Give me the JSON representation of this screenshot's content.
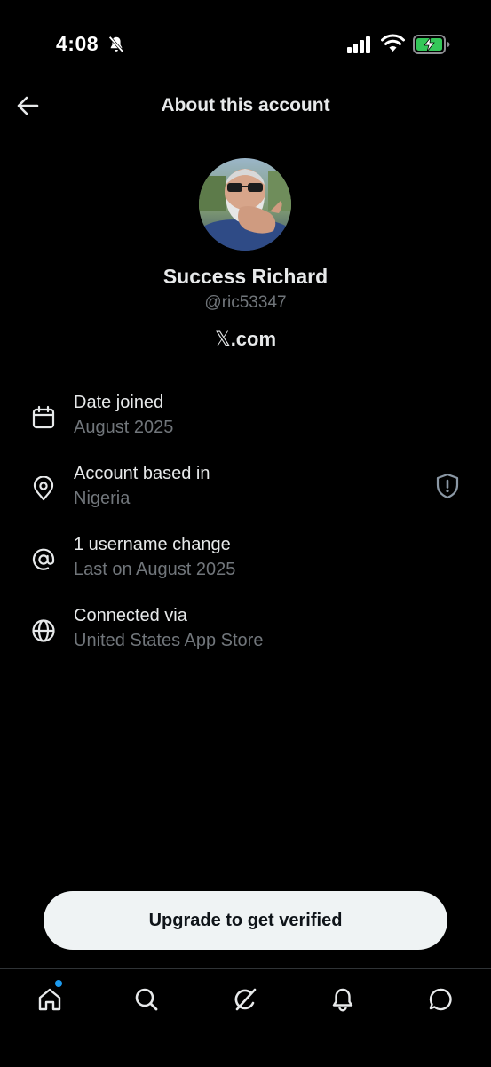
{
  "status_bar": {
    "time": "4:08",
    "icons": [
      "bell-muted-icon",
      "signal-icon",
      "wifi-icon",
      "battery-charging-icon"
    ],
    "battery_color": "#34c759"
  },
  "header": {
    "title": "About this account",
    "back_icon": "arrow-left-icon"
  },
  "profile": {
    "display_name": "Success Richard",
    "handle": "@ric53347",
    "site_glyph": "𝕏",
    "site_suffix": ".com"
  },
  "details": [
    {
      "icon": "calendar-icon",
      "title": "Date joined",
      "value": "August 2025"
    },
    {
      "icon": "location-pin-icon",
      "title": "Account based in",
      "value": "Nigeria",
      "badge_icon": "shield-alert-icon"
    },
    {
      "icon": "at-sign-icon",
      "title": "1 username change",
      "value": "Last on August 2025"
    },
    {
      "icon": "globe-icon",
      "title": "Connected via",
      "value": "United States App Store"
    }
  ],
  "cta": {
    "label": "Upgrade to get verified"
  },
  "tab_bar": {
    "tabs": [
      "home-icon",
      "search-icon",
      "grok-icon",
      "notifications-icon",
      "messages-icon"
    ],
    "notification_dot_color": "#1d9bf0"
  },
  "colors": {
    "background": "#000000",
    "primary_text": "#e7e9ea",
    "secondary_text": "#71767b",
    "button_bg": "#eff3f4"
  }
}
